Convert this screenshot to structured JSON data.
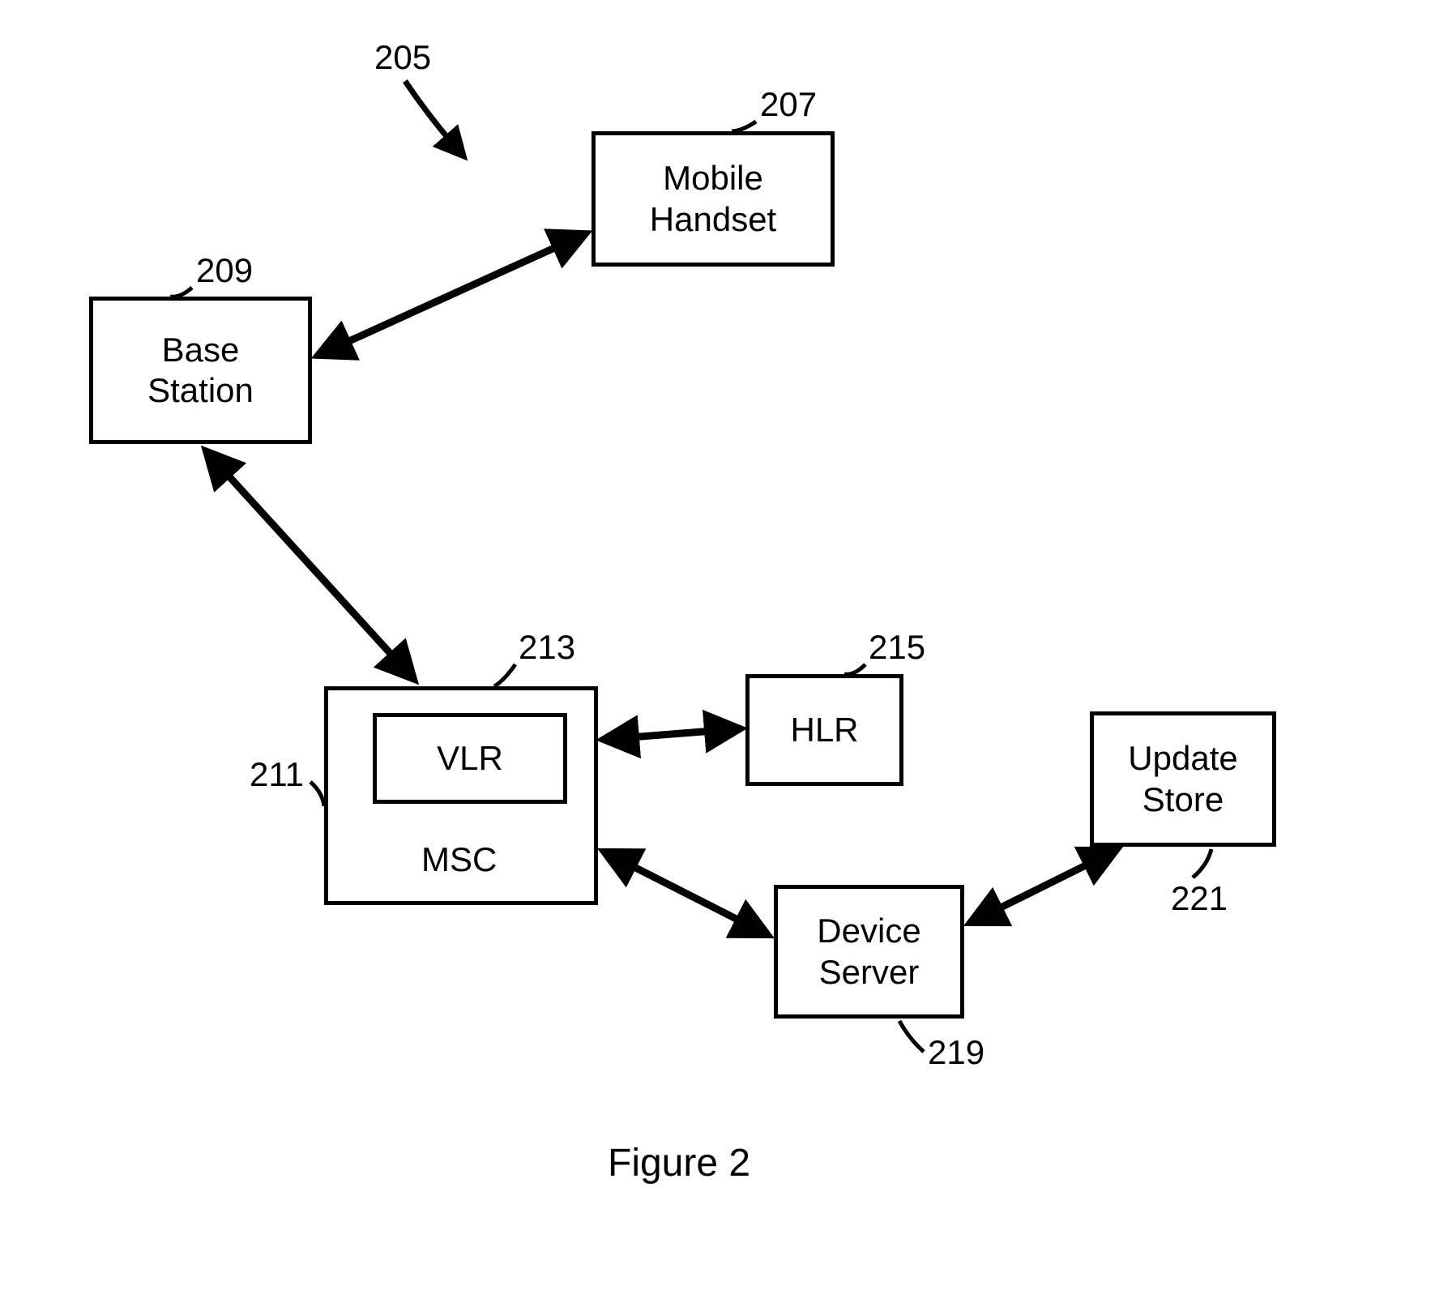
{
  "refs": {
    "r205": "205",
    "r207": "207",
    "r209": "209",
    "r211": "211",
    "r213": "213",
    "r215": "215",
    "r219": "219",
    "r221": "221"
  },
  "boxes": {
    "mobile_handset": "Mobile\nHandset",
    "base_station": "Base\nStation",
    "msc": "MSC",
    "vlr": "VLR",
    "hlr": "HLR",
    "device_server": "Device\nServer",
    "update_store": "Update\nStore"
  },
  "caption": "Figure 2"
}
